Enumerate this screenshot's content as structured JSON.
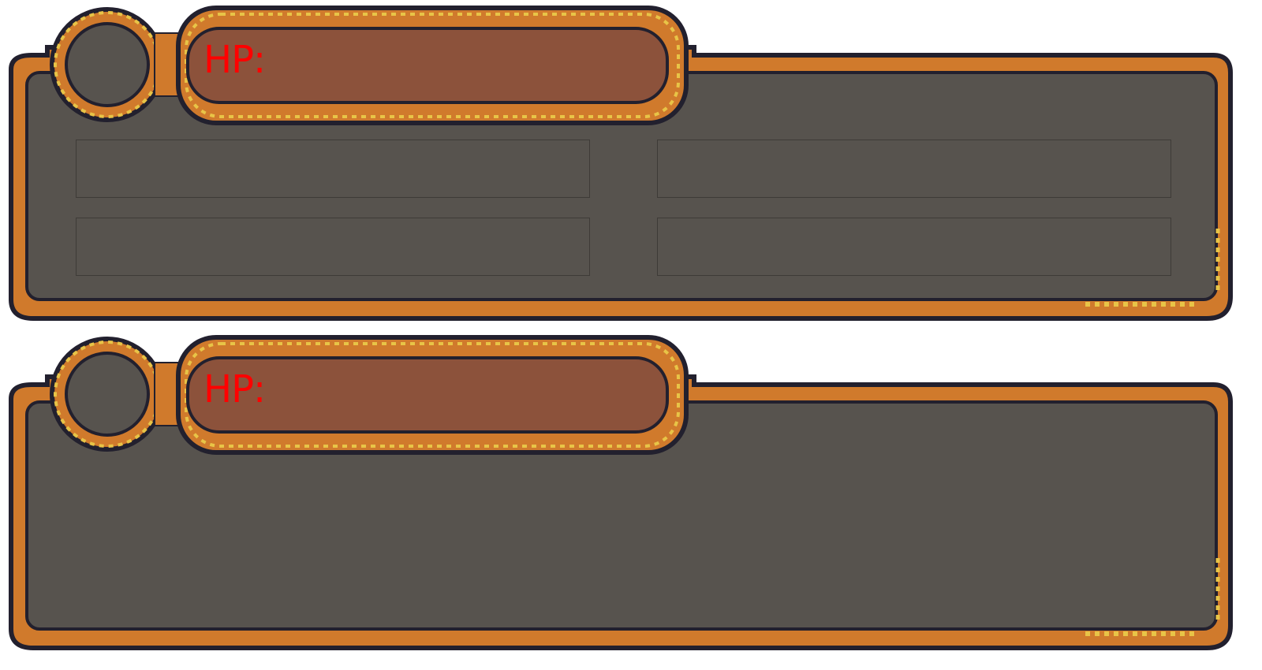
{
  "colors": {
    "frame_orange": "#d07a2c",
    "frame_outline": "#22202e",
    "frame_dots": "#e8c447",
    "panel_fill": "#57534e",
    "hp_bar_fill": "#8c523b",
    "hp_text": "#ff0000"
  },
  "icons": {
    "portrait": "empty-portrait-circle"
  },
  "panels": [
    {
      "hp_label": "HP:",
      "has_action_slots": true,
      "action_slots": [
        "",
        "",
        "",
        ""
      ]
    },
    {
      "hp_label": "HP:",
      "has_action_slots": false,
      "action_slots": []
    }
  ]
}
